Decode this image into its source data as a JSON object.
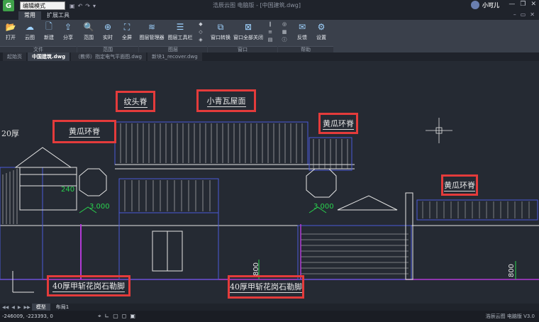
{
  "titlebar": {
    "logo_letter": "G",
    "mode_select": "编辑模式",
    "window_title": "浩辰云图 电脑版 - [中国建筑.dwg]",
    "user_name": "小可儿",
    "qat_icons": [
      "save-icon",
      "undo-icon",
      "redo-icon",
      "dropdown-icon"
    ],
    "window_controls": [
      "minimize-icon",
      "restore-icon",
      "close-icon"
    ]
  },
  "ribbon": {
    "tabs": [
      {
        "label": "常用",
        "active": true
      },
      {
        "label": "扩展工具",
        "active": false
      }
    ],
    "buttons": [
      {
        "label": "打开",
        "icon": "open-folder-icon"
      },
      {
        "label": "云图",
        "icon": "cloud-icon"
      },
      {
        "label": "新建",
        "icon": "new-file-icon"
      },
      {
        "label": "分享",
        "icon": "share-icon"
      },
      {
        "label": "范围",
        "icon": "zoom-window-icon"
      },
      {
        "label": "实时",
        "icon": "zoom-realtime-icon"
      },
      {
        "label": "全屏",
        "icon": "fullscreen-icon"
      },
      {
        "label": "图层管理器",
        "icon": "layer-manager-icon"
      },
      {
        "label": "图层工具栏",
        "icon": "layer-toolbar-icon"
      },
      {
        "label": "窗口转换",
        "icon": "window-switch-icon"
      },
      {
        "label": "窗口全部关闭",
        "icon": "close-all-windows-icon"
      },
      {
        "label": "反馈",
        "icon": "feedback-icon"
      },
      {
        "label": "设置",
        "icon": "settings-gear-icon"
      }
    ],
    "groups": [
      "文件",
      "范围",
      "图层",
      "窗口",
      "帮助"
    ]
  },
  "doc_tabs": [
    {
      "label": "起始页",
      "active": false
    },
    {
      "label": "中国建筑.dwg",
      "active": true
    },
    {
      "label": "（教师）指定电气平面图.dwg",
      "active": false
    },
    {
      "label": "新块1_recover.dwg",
      "active": false
    }
  ],
  "drawing": {
    "callouts": {
      "wentou": "纹头脊",
      "xiaoqing": "小青瓦屋面",
      "huanggua_left": "黄瓜环脊",
      "huanggua_mid": "黄瓜环脊",
      "huanggua_right": "黄瓜环脊",
      "stone_left": "40厚甲斩花岗石勒脚",
      "stone_right": "40厚甲斩花岗石勒脚"
    },
    "labels": {
      "thickness": "20厚",
      "dim_240": "240",
      "elev_left": "3.000",
      "elev_right": "3.000",
      "dim_800_a": "800",
      "dim_800_b": "800"
    },
    "colors": {
      "outline": "#4a5bd8",
      "structure": "#e6e6e6",
      "elevation": "#29d24e",
      "highlight": "#e43b3b",
      "ground": "#b23ad6"
    }
  },
  "layout_tabs": [
    {
      "label": "模型",
      "active": true
    },
    {
      "label": "布局1",
      "active": false
    }
  ],
  "statusbar": {
    "coords": "-246009, -223393, 0",
    "version": "浩辰云图 电脑版 V3.0"
  }
}
